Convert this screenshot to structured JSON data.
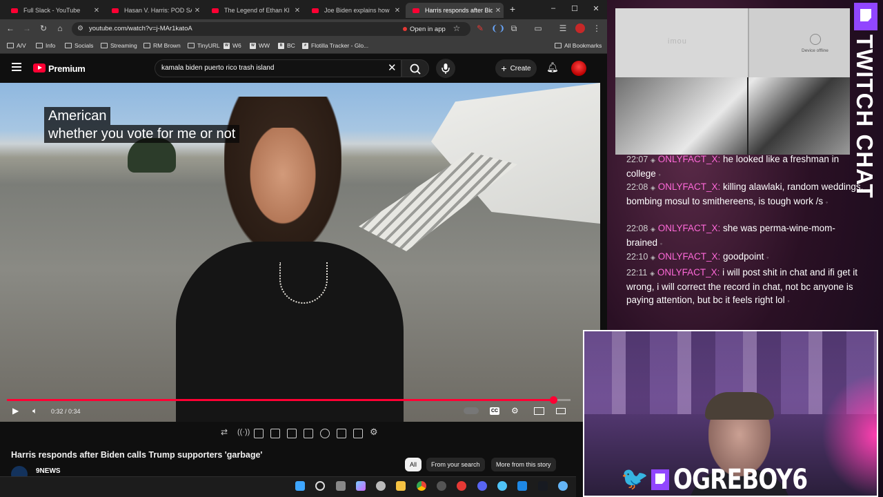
{
  "browser": {
    "tabs": [
      {
        "title": "Full Slack - YouTube"
      },
      {
        "title": "Hasan V. Harris: POD SAVE"
      },
      {
        "title": "The Legend of Ethan Kl"
      },
      {
        "title": "Joe Biden explains how"
      },
      {
        "title": "Harris responds after Biden"
      }
    ],
    "url": "youtube.com/watch?v=j-MAr1katoA",
    "open_in_app": "Open in app",
    "bookmarks": [
      "A/V",
      "Info",
      "Socials",
      "Streaming",
      "RM Brown",
      "TinyURL",
      "W6",
      "WW",
      "BC",
      "Flotilla Tracker - Glo..."
    ],
    "all_bookmarks": "All Bookmarks"
  },
  "youtube": {
    "brand": "Premium",
    "search_query": "kamala biden puerto rico trash island",
    "create_label": "Create",
    "captions": [
      "American",
      "whether you vote for me or not"
    ],
    "time_current": "0:32",
    "time_total": "0:34",
    "time_display": "0:32 / 0:34",
    "progress_fraction": 0.97,
    "video_title": "Harris responds after Biden calls Trump supporters 'garbage'",
    "channel": "9NEWS",
    "chips": [
      "All",
      "From your search",
      "More from this story"
    ],
    "accent_color": "#ff0033"
  },
  "stream_overlay": {
    "cam_brand": "imou",
    "cam_status": "Device offline",
    "panel_title": "TWITCH CHAT",
    "chat": [
      {
        "time": "22:07",
        "user": "ONLYFACT_X:",
        "msg": "he looked like a freshman in college"
      },
      {
        "time": "22:08",
        "user": "ONLYFACT_X:",
        "msg": "killing alawlaki, random weddings, bombing mosul to smithereens, is tough work /s"
      },
      {
        "time": "22:08",
        "user": "ONLYFACT_X:",
        "msg": "she was perma-wine-mom-brained"
      },
      {
        "time": "22:10",
        "user": "ONLYFACT_X:",
        "msg": "goodpoint"
      },
      {
        "time": "22:11",
        "user": "ONLYFACT_X:",
        "msg": "i will post shit in chat and ifi get it wrong, i will correct the record in chat, not bc anyone is paying attention, but bc it feels right lol"
      }
    ],
    "handle": "OGREBOY6",
    "twitch_color": "#9146ff",
    "twitter_color": "#1da1f2"
  }
}
